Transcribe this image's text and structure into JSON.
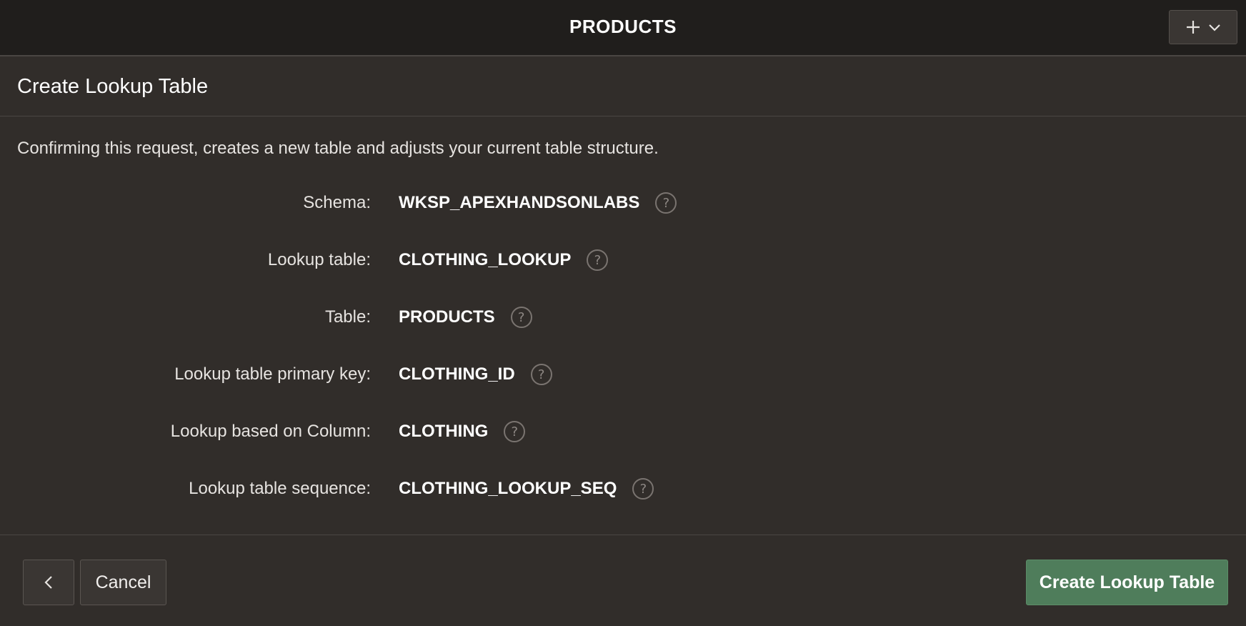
{
  "header": {
    "title": "PRODUCTS",
    "add_menu_icon": "plus-icon",
    "add_menu_chevron": "chevron-down-icon"
  },
  "dialog": {
    "title": "Create Lookup Table",
    "intro": "Confirming this request, creates a new table and adjusts your current table structure.",
    "fields": [
      {
        "label": "Schema:",
        "value": "WKSP_APEXHANDSONLABS",
        "help": "?"
      },
      {
        "label": "Lookup table:",
        "value": "CLOTHING_LOOKUP",
        "help": "?"
      },
      {
        "label": "Table:",
        "value": "PRODUCTS",
        "help": "?"
      },
      {
        "label": "Lookup table primary key:",
        "value": "CLOTHING_ID",
        "help": "?"
      },
      {
        "label": "Lookup based on Column:",
        "value": "CLOTHING",
        "help": "?"
      },
      {
        "label": "Lookup table sequence:",
        "value": "CLOTHING_LOOKUP_SEQ",
        "help": "?"
      }
    ]
  },
  "footer": {
    "back_icon": "chevron-left-icon",
    "cancel_label": "Cancel",
    "create_label": "Create Lookup Table"
  },
  "colors": {
    "background": "#312d2a",
    "topbar": "#201e1c",
    "primary_button": "#4f7d5b"
  }
}
